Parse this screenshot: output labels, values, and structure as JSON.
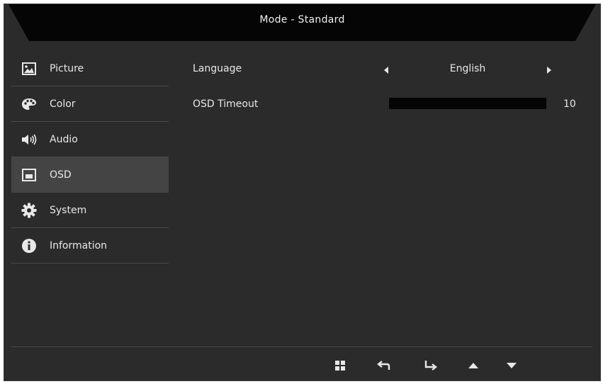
{
  "header": {
    "title": "Mode - Standard"
  },
  "sidebar": {
    "items": [
      {
        "label": "Picture",
        "icon": "picture-icon"
      },
      {
        "label": "Color",
        "icon": "palette-icon"
      },
      {
        "label": "Audio",
        "icon": "speaker-icon"
      },
      {
        "label": "OSD",
        "icon": "osd-icon",
        "active": true
      },
      {
        "label": "System",
        "icon": "gear-icon"
      },
      {
        "label": "Information",
        "icon": "info-icon"
      }
    ]
  },
  "settings": {
    "language": {
      "label": "Language",
      "value": "English"
    },
    "osd_timeout": {
      "label": "OSD Timeout",
      "value": "10"
    }
  },
  "footer": {
    "buttons": [
      "menu-grid-icon",
      "back-arrow-icon",
      "enter-arrow-icon",
      "up-arrow-icon",
      "down-arrow-icon"
    ]
  },
  "colors": {
    "background": "#2b2b2b",
    "header": "#050505",
    "active_item": "#444444",
    "text": "#e8e8e8"
  }
}
